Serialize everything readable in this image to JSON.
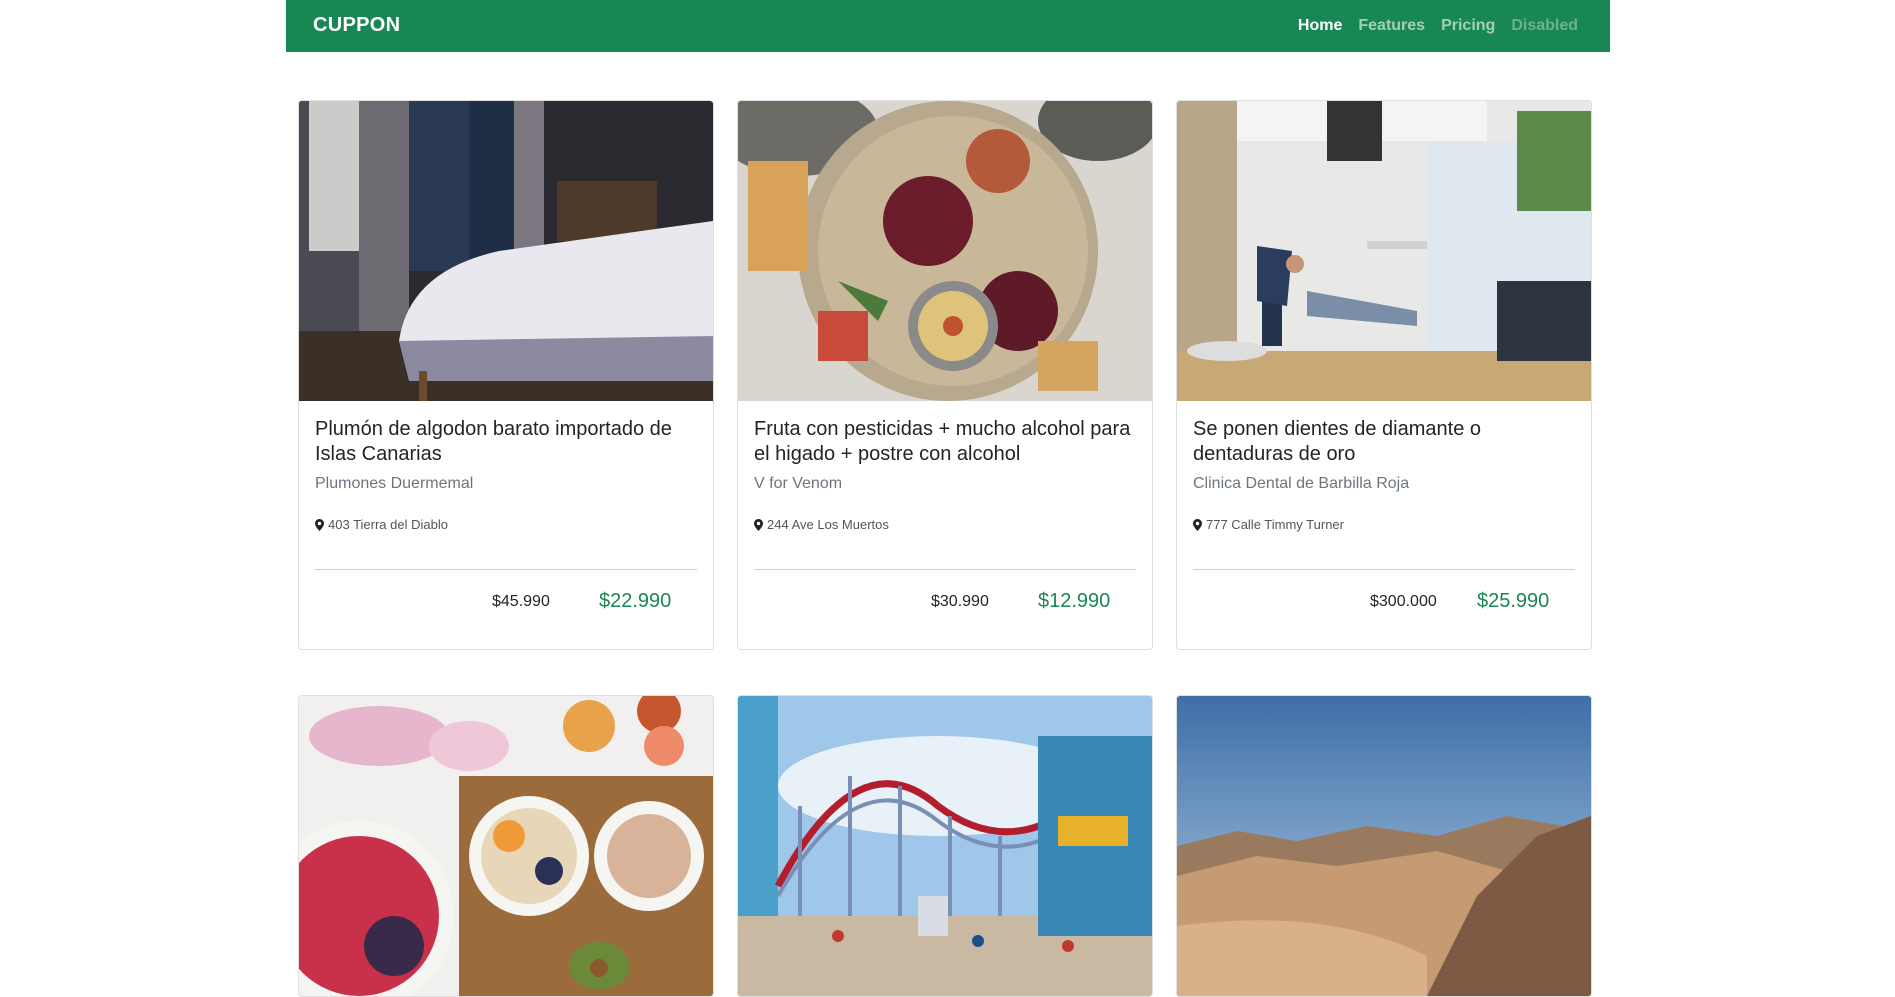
{
  "nav": {
    "brand": "CUPPON",
    "links": [
      {
        "label": "Home",
        "state": "active"
      },
      {
        "label": "Features",
        "state": "normal"
      },
      {
        "label": "Pricing",
        "state": "normal"
      },
      {
        "label": "Disabled",
        "state": "disabled"
      }
    ]
  },
  "colors": {
    "brand": "#198754",
    "price": "#198754",
    "muted": "#6c757d"
  },
  "cards": [
    {
      "image": "bedroom-bed-photo",
      "title": "Plumón de algodon barato importado de Islas Canarias",
      "subtitle": "Plumones Duermemal",
      "address": "403 Tierra del Diablo",
      "old_price": "$45.990",
      "new_price": "$22.990"
    },
    {
      "image": "food-platter-photo",
      "title": "Fruta con pesticidas + mucho alcohol para el higado + postre con alcohol",
      "subtitle": "V for Venom",
      "address": "244 Ave Los Muertos",
      "old_price": "$30.990",
      "new_price": "$12.990"
    },
    {
      "image": "dental-clinic-photo",
      "title": "Se ponen dientes de diamante o dentaduras de oro",
      "subtitle": "Clinica Dental de Barbilla Roja",
      "address": "777 Calle Timmy Turner",
      "old_price": "$300.000",
      "new_price": "$25.990"
    },
    {
      "image": "breakfast-bowls-photo"
    },
    {
      "image": "amusement-park-photo"
    },
    {
      "image": "desert-mountains-photo"
    }
  ]
}
